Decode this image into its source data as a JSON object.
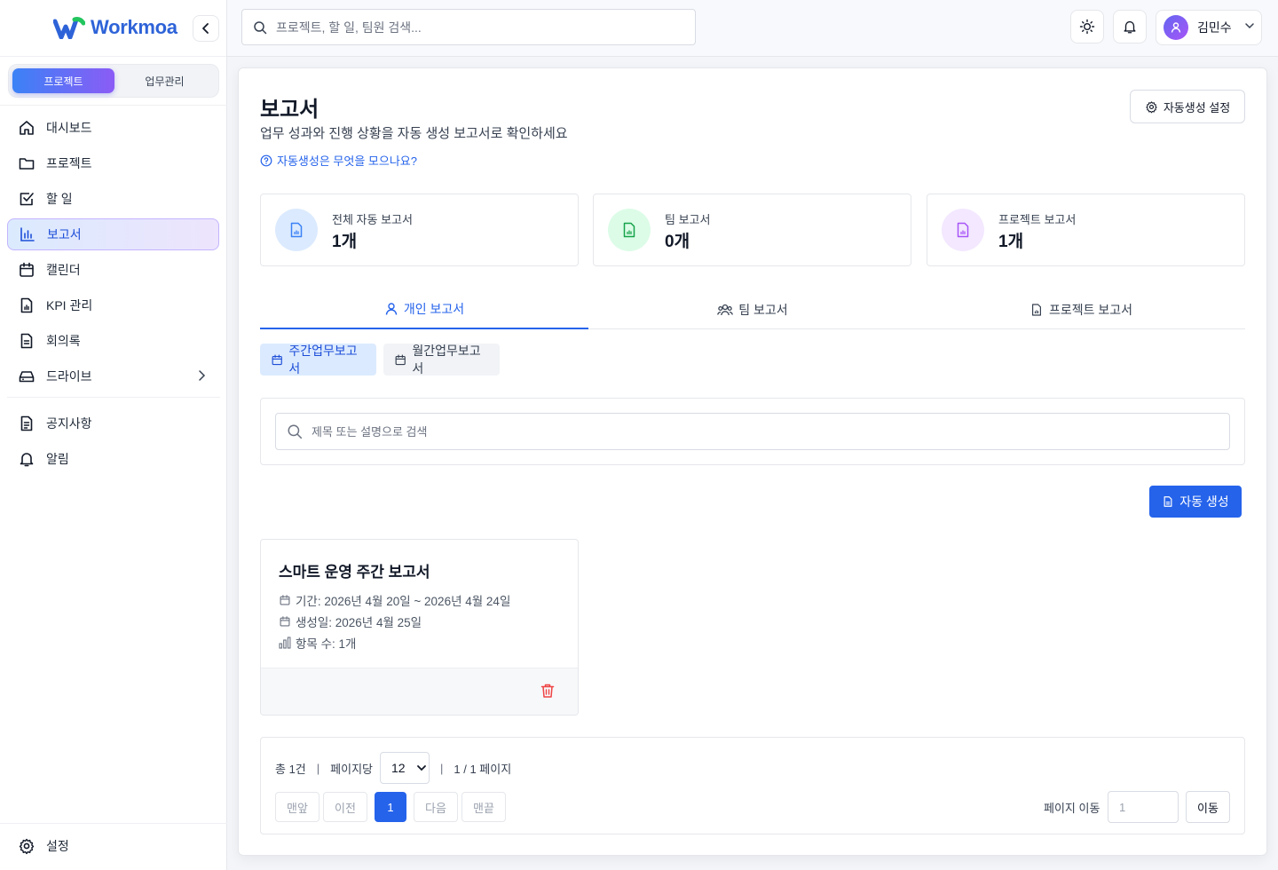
{
  "app": {
    "name": "Workmoa"
  },
  "colors": {
    "primary": "#2563eb",
    "accent_purple": "#8b5cf6",
    "success": "#16a34a",
    "danger": "#ef4444"
  },
  "sidebar": {
    "mode_tabs": [
      {
        "label": "프로젝트",
        "active": true
      },
      {
        "label": "업무관리",
        "active": false
      }
    ],
    "items": [
      {
        "label": "대시보드",
        "icon": "home-icon"
      },
      {
        "label": "프로젝트",
        "icon": "folder-icon"
      },
      {
        "label": "할 일",
        "icon": "checkbox-icon"
      },
      {
        "label": "보고서",
        "icon": "bar-chart-icon",
        "active": true
      },
      {
        "label": "캘린더",
        "icon": "calendar-icon"
      },
      {
        "label": "KPI 관리",
        "icon": "kpi-file-icon"
      },
      {
        "label": "회의록",
        "icon": "document-icon"
      },
      {
        "label": "드라이브",
        "icon": "drive-icon",
        "has_submenu": true
      }
    ],
    "secondary_items": [
      {
        "label": "공지사항",
        "icon": "notice-icon"
      },
      {
        "label": "알림",
        "icon": "bell-icon"
      }
    ],
    "settings_label": "설정"
  },
  "header": {
    "search_placeholder": "프로젝트, 할 일, 팀원 검색...",
    "user_name": "김민수"
  },
  "page": {
    "title": "보고서",
    "subtitle": "업무 성과와 진행 상황을 자동 생성 보고서로 확인하세요",
    "help_link": "자동생성은 무엇을 모으나요?",
    "auto_settings_label": "자동생성 설정"
  },
  "stats": [
    {
      "label": "전체 자동 보고서",
      "value": "1개",
      "color": "#3b82f6",
      "bg": "#dbeafe"
    },
    {
      "label": "팀 보고서",
      "value": "0개",
      "color": "#16a34a",
      "bg": "#dcfce7"
    },
    {
      "label": "프로젝트 보고서",
      "value": "1개",
      "color": "#a855f7",
      "bg": "#f3e8ff"
    }
  ],
  "tabs": [
    {
      "label": "개인 보고서",
      "active": true
    },
    {
      "label": "팀 보고서",
      "active": false
    },
    {
      "label": "프로젝트 보고서",
      "active": false
    }
  ],
  "subtabs": [
    {
      "label": "주간업무보고서",
      "active": true
    },
    {
      "label": "월간업무보고서",
      "active": false
    }
  ],
  "report_search": {
    "placeholder": "제목 또는 설명으로 검색"
  },
  "generate_button": "자동 생성",
  "reports": [
    {
      "title": "스마트 운영 주간 보고서",
      "period": "기간: 2026년 4월 20일 ~ 2026년 4월 24일",
      "created": "생성일: 2026년 4월 25일",
      "items": "항목 수: 1개"
    }
  ],
  "pagination": {
    "total": "총 1건",
    "per_page_label": "페이지당",
    "per_page_value": "12",
    "page_info": "1 / 1 페이지",
    "first": "맨앞",
    "prev": "이전",
    "current": "1",
    "next": "다음",
    "last": "맨끝",
    "goto_label": "페이지 이동",
    "goto_placeholder": "1",
    "goto_button": "이동"
  }
}
